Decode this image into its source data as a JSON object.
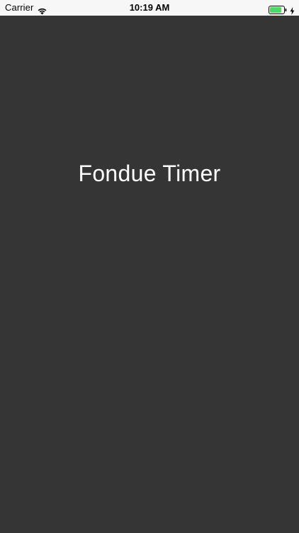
{
  "status_bar": {
    "carrier": "Carrier",
    "time": "10:19 AM",
    "wifi_icon": "wifi-icon",
    "battery_icon": "battery-icon",
    "charging_icon": "charging-bolt-icon",
    "battery_color": "#4cd964",
    "battery_level": 0.85
  },
  "main": {
    "title": "Fondue Timer",
    "background_color": "#353535",
    "text_color": "#ffffff"
  }
}
